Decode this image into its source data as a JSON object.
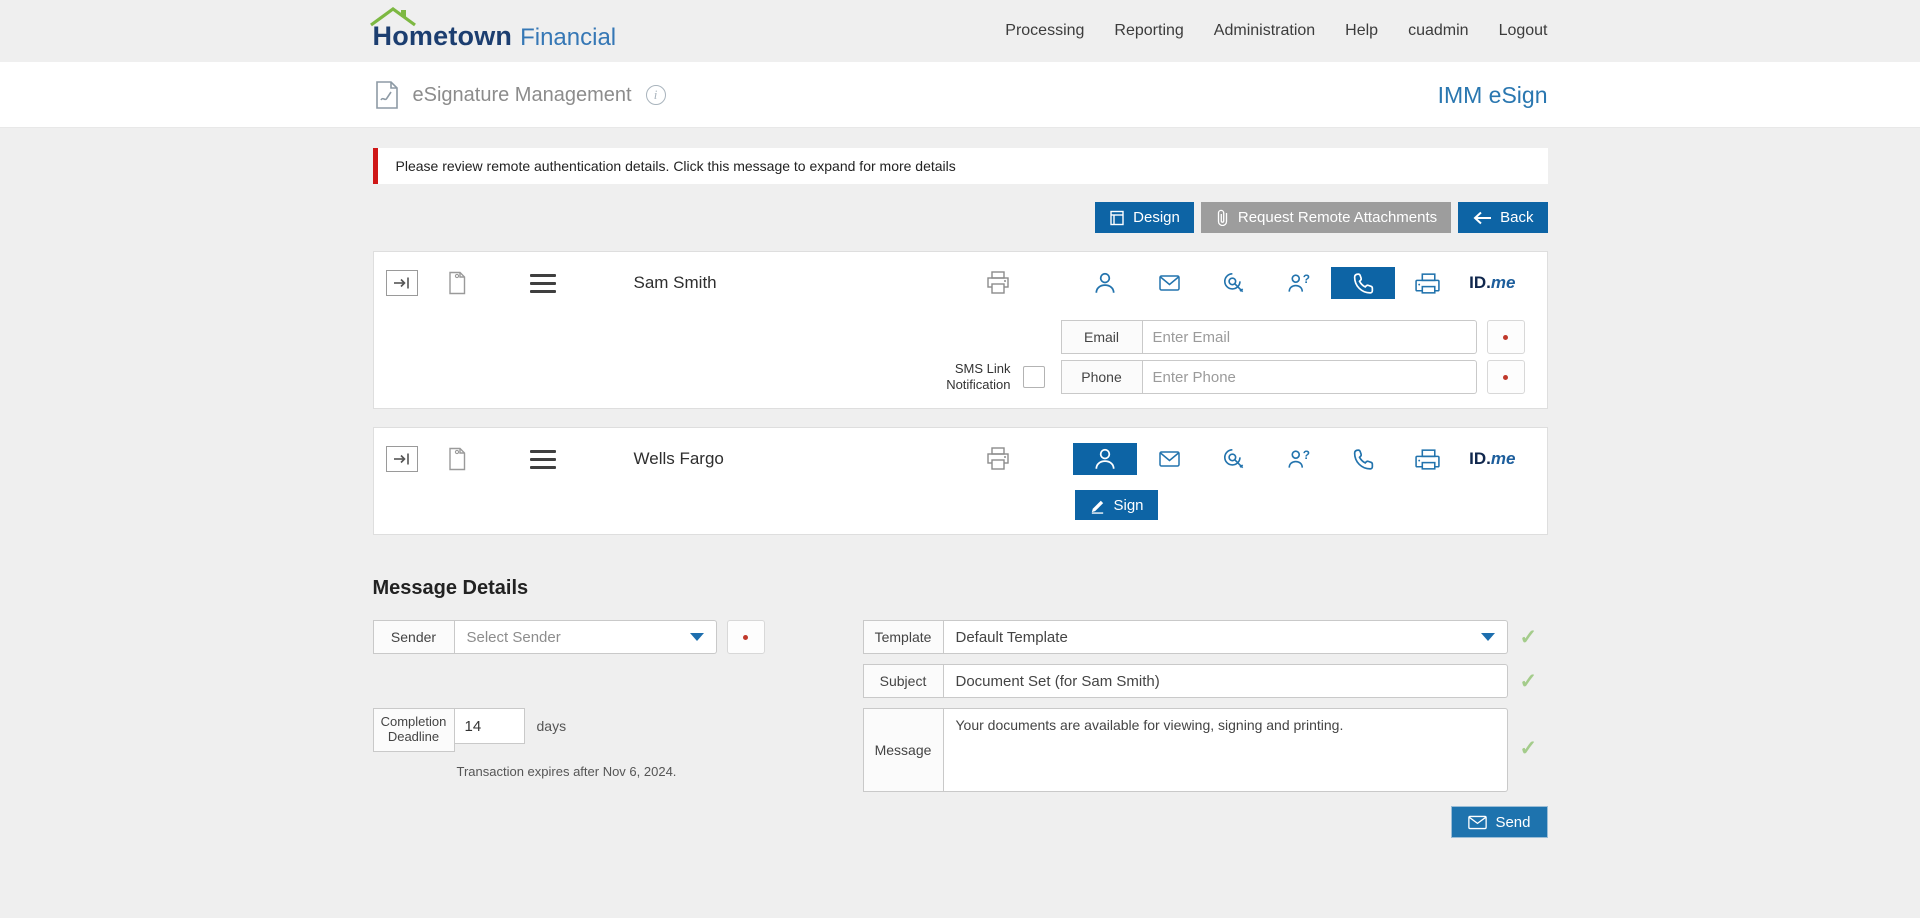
{
  "brand": {
    "name": "Hometown",
    "suffix": "Financial"
  },
  "nav": {
    "items": [
      "Processing",
      "Reporting",
      "Administration",
      "Help",
      "cuadmin",
      "Logout"
    ]
  },
  "header": {
    "title": "eSignature Management",
    "product": "IMM eSign"
  },
  "alert": {
    "text": "Please review remote authentication details. Click this message to expand for more details"
  },
  "toolbar": {
    "design": "Design",
    "request_attachments": "Request Remote Attachments",
    "back": "Back"
  },
  "signers": [
    {
      "name": "Sam Smith",
      "selected_auth": "phone",
      "fields": {
        "email_label": "Email",
        "email_placeholder": "Enter Email",
        "sms_label_line1": "SMS Link",
        "sms_label_line2": "Notification",
        "phone_label": "Phone",
        "phone_placeholder": "Enter Phone"
      }
    },
    {
      "name": "Wells Fargo",
      "selected_auth": "user",
      "sign_label": "Sign"
    }
  ],
  "idme": {
    "id": "ID.",
    "me": "me"
  },
  "message_details": {
    "heading": "Message Details",
    "sender_label": "Sender",
    "sender_value": "Select Sender",
    "completion_label_line1": "Completion",
    "completion_label_line2": "Deadline",
    "completion_value": "14",
    "days_label": "days",
    "expires_note": "Transaction expires after Nov 6, 2024.",
    "template_label": "Template",
    "template_value": "Default Template",
    "subject_label": "Subject",
    "subject_value": "Document Set (for Sam Smith)",
    "message_label": "Message",
    "message_value": "Your documents are available for viewing, signing and printing.",
    "send_label": "Send"
  },
  "colors": {
    "accent_blue": "#0d64a5",
    "muted_button_gray": "#9d9d9d",
    "alert_red": "#cf1717",
    "check_green": "#a4cc8b",
    "logo_green": "#7db842",
    "brand_navy": "#1c3e70",
    "brand_blue": "#3577b5",
    "product_blue": "#2a77b0"
  }
}
